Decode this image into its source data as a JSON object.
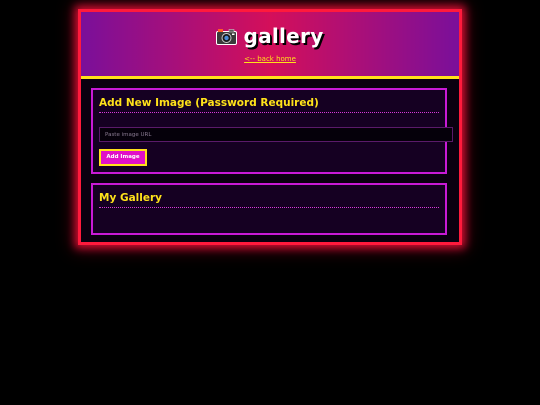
{
  "header": {
    "title": "gallery",
    "back_link": "<-- back home",
    "icon": "camera-icon"
  },
  "add_panel": {
    "title": "Add New Image (Password Required)",
    "url_placeholder": "Paste image URL",
    "url_value": "",
    "add_button_label": "Add Image"
  },
  "gallery_panel": {
    "title": "My Gallery"
  },
  "colors": {
    "background": "#000000",
    "frame_border": "#ff1a3c",
    "accent_yellow": "#ffe21a",
    "panel_border": "#c81ad6",
    "button_fill": "#e010c8"
  }
}
